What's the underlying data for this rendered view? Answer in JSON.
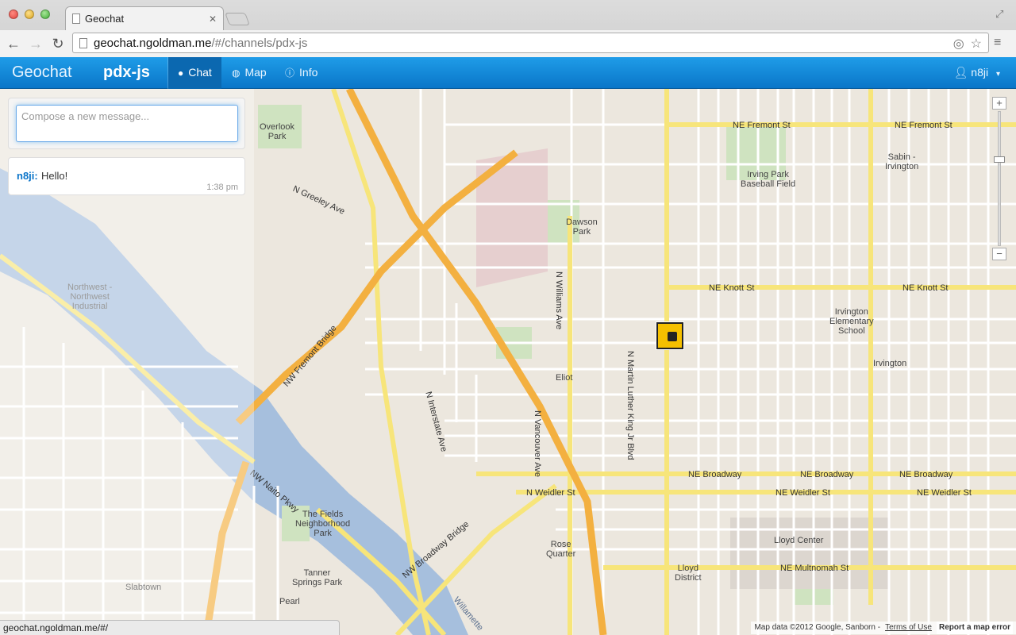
{
  "browser": {
    "tab_title": "Geochat",
    "tab_close": "✕",
    "url_host": "geochat.ngoldman.me",
    "url_path": "/#/channels/pdx-js",
    "status_url": "geochat.ngoldman.me/#/"
  },
  "navbar": {
    "brand": "Geochat",
    "channel": "pdx-js",
    "items": [
      {
        "label": "Chat",
        "icon": "chat-bubble-icon",
        "active": true
      },
      {
        "label": "Map",
        "icon": "globe-icon",
        "active": false
      },
      {
        "label": "Info",
        "icon": "info-icon",
        "active": false
      }
    ],
    "user": "n8ji",
    "accent": "#1a8fdc"
  },
  "chat": {
    "compose_placeholder": "Compose a new message...",
    "messages": [
      {
        "user": "n8ji:",
        "text": "Hello!",
        "time": "1:38 pm"
      }
    ]
  },
  "map": {
    "zoom_in": "+",
    "zoom_out": "−",
    "attribution": "Map data ©2012 Google, Sanborn -",
    "terms": "Terms of Use",
    "report": "Report a map error",
    "labels": {
      "fremont": "NE Fremont St",
      "fremont_w": "NE Fremont St",
      "knott": "NE Knott St",
      "knott_w": "NE Knott St",
      "broadway": "NE Broadway",
      "broadway_w": "NE Broadway",
      "broadway_e": "NE Broadway",
      "weidler": "NE Weidler St",
      "weidler_w": "N Weidler St",
      "weidler_e": "NE Weidler St",
      "multnomah": "NE Multnomah St",
      "mlk": "N Martin Luther King Jr Blvd",
      "overlook": "Overlook\nPark",
      "dawson": "Dawson\nPark",
      "eliot": "Eliot",
      "irvington": "Irvington",
      "sabin": "Sabin -\nIrvington",
      "irving_park": "Irving Park\nBaseball Field",
      "irv_school": "Irvington\nElementary\nSchool",
      "rose_quarter": "Rose\nQuarter",
      "lloyd_center": "Lloyd Center",
      "lloyd_district": "Lloyd\nDistrict",
      "fields": "The Fields\nNeighborhood\nPark",
      "tanner": "Tanner\nSprings Park",
      "slabtown": "Slabtown",
      "pearl": "Pearl",
      "nw_industrial": "Northwest -\nNorthwest\nIndustrial",
      "fremont_bridge": "NW Fremont Bridge",
      "broadway_bridge": "NW Broadway Bridge",
      "interstate": "N Interstate Ave",
      "greeley": "N Greeley Ave",
      "vancouver": "N Vancouver Ave",
      "williams": "N Williams Ave",
      "naito": "NW Naito Pkwy",
      "willamette": "Willamette"
    }
  }
}
